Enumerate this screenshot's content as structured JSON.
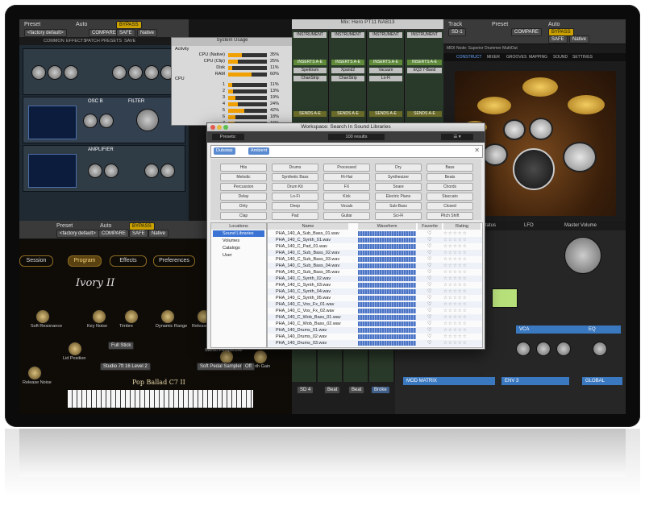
{
  "synth": {
    "preset_label": "Preset",
    "auto_label": "Auto",
    "preset_value": "<factory default>",
    "compare": "COMPARE",
    "safe": "SAFE",
    "bypass": "BYPASS",
    "native": "Native",
    "tabs": [
      "COMMON",
      "EFFECTS",
      "PATCH PRESETS",
      "SAVE"
    ],
    "osc_label": "OSC B",
    "filter_label": "FILTER",
    "amp_label": "AMPLIFIER"
  },
  "system_usage": {
    "title": "System Usage",
    "activity_label": "Activity",
    "cpu_label": "CPU",
    "activity": [
      {
        "label": "CPU (Native)",
        "pct": "35%",
        "fill": 0.35
      },
      {
        "label": "CPU (Clip)",
        "pct": "25%",
        "fill": 0.25
      },
      {
        "label": "Disk",
        "pct": "11%",
        "fill": 0.11
      },
      {
        "label": "RAM",
        "pct": "60%",
        "fill": 0.6
      }
    ],
    "cores": [
      {
        "label": "1",
        "pct": "11%",
        "fill": 0.11
      },
      {
        "label": "2",
        "pct": "13%",
        "fill": 0.13
      },
      {
        "label": "3",
        "pct": "19%",
        "fill": 0.19
      },
      {
        "label": "4",
        "pct": "24%",
        "fill": 0.24
      },
      {
        "label": "5",
        "pct": "42%",
        "fill": 0.42
      },
      {
        "label": "6",
        "pct": "18%",
        "fill": 0.18
      },
      {
        "label": "7",
        "pct": "16%",
        "fill": 0.16
      },
      {
        "label": "8",
        "pct": "8%",
        "fill": 0.08
      }
    ]
  },
  "mix": {
    "title": "Mix: Hero PT11 NAB13",
    "instrument_label": "INSTRUMENT",
    "inserts_label": "INSERTS A-E",
    "sends_label": "SENDS A-E",
    "inserts": [
      "Spektrum",
      "Xpand2",
      "Vacuum",
      "ChanStrip",
      "Lo-Fi",
      "EQ3 7-Band"
    ]
  },
  "drummer": {
    "track_label": "Track",
    "preset_label": "Preset",
    "auto_label": "Auto",
    "track_value": "SD-1",
    "compare": "COMPARE",
    "safe": "SAFE",
    "bypass": "BYPASS",
    "native": "Native",
    "title": "MIDI Node: Superior Drummer MultiOut",
    "tabs": [
      "CONSTRUCT",
      "MIXER",
      "GROOVES",
      "MAPPING",
      "SOUND",
      "SETTINGS"
    ]
  },
  "ivory": {
    "preset_label": "Preset",
    "auto_label": "Auto",
    "preset_value": "<factory default>",
    "compare": "COMPARE",
    "safe": "SAFE",
    "bypass": "BYPASS",
    "native": "Native",
    "tabs": [
      "Session",
      "Program",
      "Effects",
      "Preferences"
    ],
    "brand": "Ivory II",
    "piano_name": "Pop Ballad C7 II",
    "knob_labels": [
      "Soft Resonance",
      "Key Noise",
      "Timbre",
      "Dynamic Range",
      "Release Samples",
      "Synth Decay",
      "Synth Gain",
      "Release Noise",
      "Lid Position",
      "Stereo Perspective"
    ],
    "keyset_value": "Studio 7ft 16 Level 2",
    "soft_pedal": "Soft Pedal Sampler",
    "off": "Off",
    "lid_value": "Full Stick"
  },
  "workspace": {
    "title": "Workspace: Search In Sound Libraries",
    "results": "100 results",
    "presets_label": "Presets:",
    "chips": [
      "Dubstep",
      "Ambient"
    ],
    "tags": [
      [
        "Hits",
        "Drums",
        "Processed",
        "Dry",
        "Bass"
      ],
      [
        "Melodic",
        "Synthetic Bass",
        "Hi-Hat",
        "Synthesizer",
        "Beats"
      ],
      [
        "Percussion",
        "Drum Kit",
        "FX",
        "Snare",
        "Chords"
      ],
      [
        "Delay",
        "Lo-Fi",
        "Kick",
        "Electric Piano",
        "Staccato"
      ],
      [
        "Dirty",
        "Deep",
        "Vocals",
        "Sub-Bass",
        "Closed"
      ],
      [
        "Clap",
        "Pad",
        "Guitar",
        "Sci-Fi",
        "Pitch Shift"
      ]
    ],
    "locations_header": "Locations",
    "locations": [
      "Sound Libraries",
      "Volumes",
      "Catalogs",
      "User"
    ],
    "columns": {
      "name": "Name",
      "waveform": "Waveform",
      "favorite": "Favorite",
      "rating": "Rating"
    },
    "files": [
      "PHA_140_A_Sub_Bass_01.wav",
      "PHA_140_C_Synth_01.wav",
      "PHA_140_C_Pad_01.wav",
      "PHA_140_C_Sub_Bass_02.wav",
      "PHA_140_C_Sub_Bass_03.wav",
      "PHA_140_C_Sub_Bass_04.wav",
      "PHA_140_C_Sub_Bass_05.wav",
      "PHA_140_C_Synth_02.wav",
      "PHA_140_C_Synth_03.wav",
      "PHA_140_C_Synth_04.wav",
      "PHA_140_C_Synth_05.wav",
      "PHA_140_C_Vox_Fx_01.wav",
      "PHA_140_C_Vox_Fx_02.wav",
      "PHA_140_C_Wob_Bass_01.wav",
      "PHA_140_C_Wob_Bass_02.wav",
      "PHA_140_Drums_01.wav",
      "PHA_140_Drums_02.wav",
      "PHA_140_Drums_03.wav"
    ]
  },
  "synth2": {
    "labels": [
      "Status",
      "LFO",
      "Master Volume",
      "VCA",
      "EQ",
      "MOD MATRIX",
      "ENV 3",
      "GLOBAL"
    ]
  },
  "edit": {
    "labels": [
      "SD 4",
      "Beat",
      "Beat",
      "Broke"
    ]
  }
}
